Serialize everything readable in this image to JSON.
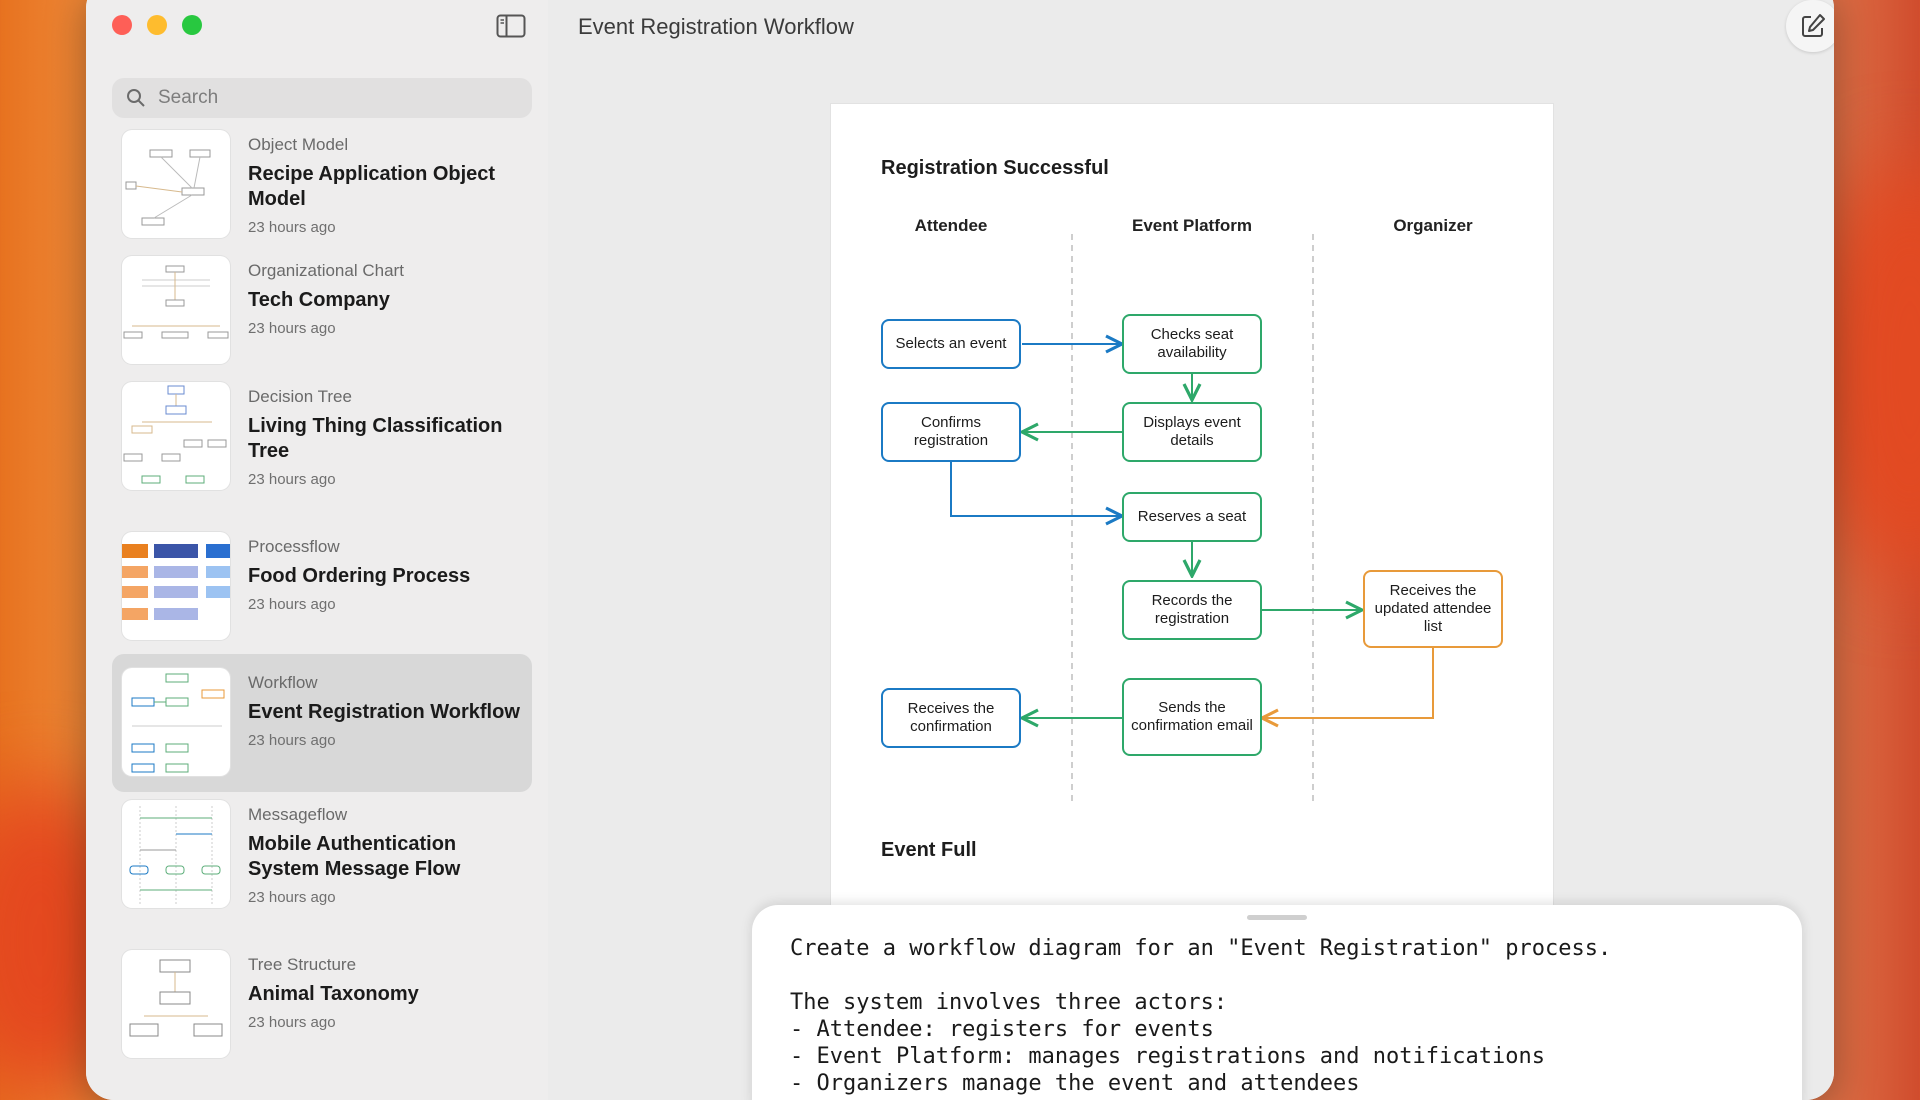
{
  "sidebar": {
    "search_placeholder": "Search",
    "items": [
      {
        "category": "Object Model",
        "title": "Recipe Application Object Model",
        "time": "23 hours ago"
      },
      {
        "category": "Organizational Chart",
        "title": "Tech Company",
        "time": "23 hours ago"
      },
      {
        "category": "Decision Tree",
        "title": "Living Thing Classification Tree",
        "time": "23 hours ago"
      },
      {
        "category": "Processflow",
        "title": "Food Ordering Process",
        "time": "23 hours ago"
      },
      {
        "category": "Workflow",
        "title": "Event Registration Workflow",
        "time": "23 hours ago"
      },
      {
        "category": "Messageflow",
        "title": "Mobile Authentication System Message Flow",
        "time": "23 hours ago"
      },
      {
        "category": "Tree Structure",
        "title": "Animal Taxonomy",
        "time": "23 hours ago"
      }
    ]
  },
  "main": {
    "title": "Event Registration Workflow"
  },
  "diagram": {
    "section1_title": "Registration Successful",
    "section2_title": "Event Full",
    "lanes": [
      "Attendee",
      "Event Platform",
      "Organizer"
    ],
    "nodes": {
      "selects": "Selects an event",
      "checks": "Checks seat availability",
      "displays": "Displays event details",
      "confirms": "Confirms registration",
      "reserves": "Reserves a seat",
      "records": "Records the registration",
      "receives_list": "Receives the updated attendee list",
      "sends": "Sends the confirmation email",
      "receives_conf": "Receives the confirmation"
    },
    "colors": {
      "blue": "#1b7ac4",
      "green": "#2ea86a",
      "orange": "#e89a3a"
    }
  },
  "prompt": {
    "lines": [
      "Create a workflow diagram for an \"Event Registration\" process.",
      "",
      "The system involves three actors:",
      "- Attendee: registers for events",
      "- Event Platform: manages registrations and notifications",
      "- Organizers manage the event and attendees"
    ]
  },
  "icons": {
    "sidebar_toggle": "sidebar-toggle-icon",
    "search": "search-icon",
    "compose": "compose-icon",
    "share": "share-icon",
    "chevron": "chevron-down-icon"
  }
}
